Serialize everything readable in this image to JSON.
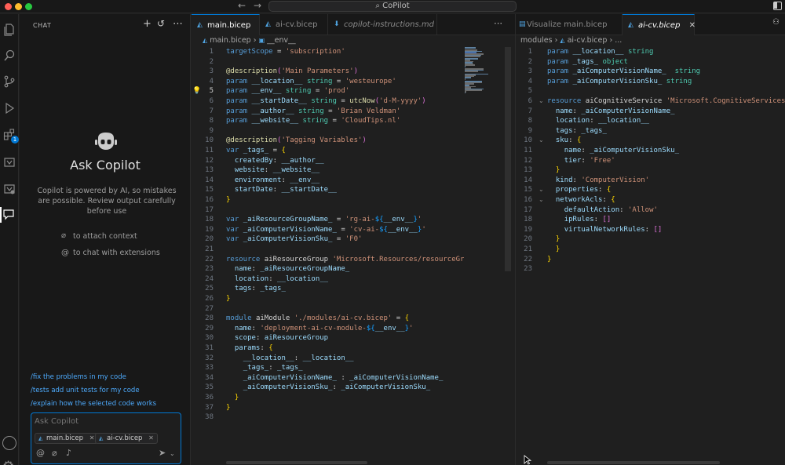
{
  "titlebar": {
    "title": "CoPilot",
    "back_arrow": "←",
    "forward_arrow": "→"
  },
  "activitybar": {
    "badge_count": "1"
  },
  "chat": {
    "title": "CHAT",
    "heading": "Ask Copilot",
    "disclaimer": "Copilot is powered by AI, so mistakes are possible. Review output carefully before use",
    "hint_attach": "to attach context",
    "hint_extensions": "to chat with extensions",
    "suggestions": [
      "/fix the problems in my code",
      "/tests add unit tests for my code",
      "/explain how the selected code works"
    ],
    "input_placeholder": "Ask Copilot",
    "attachments": [
      "main.bicep",
      "ai-cv.bicep"
    ]
  },
  "left_editor": {
    "tabs": [
      {
        "label": "main.bicep",
        "active": true
      },
      {
        "label": "ai-cv.bicep",
        "active": false
      },
      {
        "label": "copilot-instructions.md",
        "active": false
      }
    ],
    "breadcrumb": [
      "main.bicep",
      "__env__"
    ],
    "current_line": 5,
    "lines": [
      "targetScope = 'subscription'",
      "",
      "@description('Main Parameters')",
      "param __location__ string = 'westeurope'",
      "param __env__ string = 'prod'",
      "param __startDate__ string = utcNow('d-M-yyyy')",
      "param __author__ string = 'Brian Veldman'",
      "param __website__ string = 'CloudTips.nl'",
      "",
      "@description('Tagging Variables')",
      "var _tags_ = {",
      "  createdBy: __author__",
      "  website: __website__",
      "  environment: __env__",
      "  startDate: __startDate__",
      "}",
      "",
      "var _aiResourceGroupName_ = 'rg-ai-${__env__}'",
      "var _aiComputerVisionName_ = 'cv-ai-${__env__}'",
      "var _aiComputerVisionSku_ = 'F0'",
      "",
      "resource aiResourceGroup 'Microsoft.Resources/resourceGroups@",
      "  name: _aiResourceGroupName_",
      "  location: __location__",
      "  tags: _tags_",
      "}",
      "",
      "module aiModule './modules/ai-cv.bicep' = {",
      "  name: 'deployment-ai-cv-module-${__env__}'",
      "  scope: aiResourceGroup",
      "  params: {",
      "    __location__: __location__",
      "    _tags_: _tags_",
      "    _aiComputerVisionName_ : _aiComputerVisionName_",
      "    _aiComputerVisionSku_: _aiComputerVisionSku_",
      "  }",
      "}",
      ""
    ]
  },
  "right_editor": {
    "tabs": [
      {
        "label": "Visualize main.bicep",
        "active": false
      },
      {
        "label": "ai-cv.bicep",
        "active": true
      }
    ],
    "breadcrumb": [
      "modules",
      "ai-cv.bicep",
      "..."
    ],
    "lines": [
      "param __location__ string",
      "param _tags_ object",
      "param _aiComputerVisionName_  string",
      "param _aiComputerVisionSku_ string",
      "",
      "resource aiCognitiveService 'Microsoft.CognitiveServices/acco",
      "  name: _aiComputerVisionName_",
      "  location: __location__",
      "  tags: _tags_",
      "  sku: {",
      "    name: _aiComputerVisionSku_",
      "    tier: 'Free'",
      "  }",
      "  kind: 'ComputerVision'",
      "  properties: {",
      "  networkAcls: {",
      "    defaultAction: 'Allow'",
      "    ipRules: []",
      "    virtualNetworkRules: []",
      "  }",
      "  }",
      "}",
      ""
    ]
  }
}
